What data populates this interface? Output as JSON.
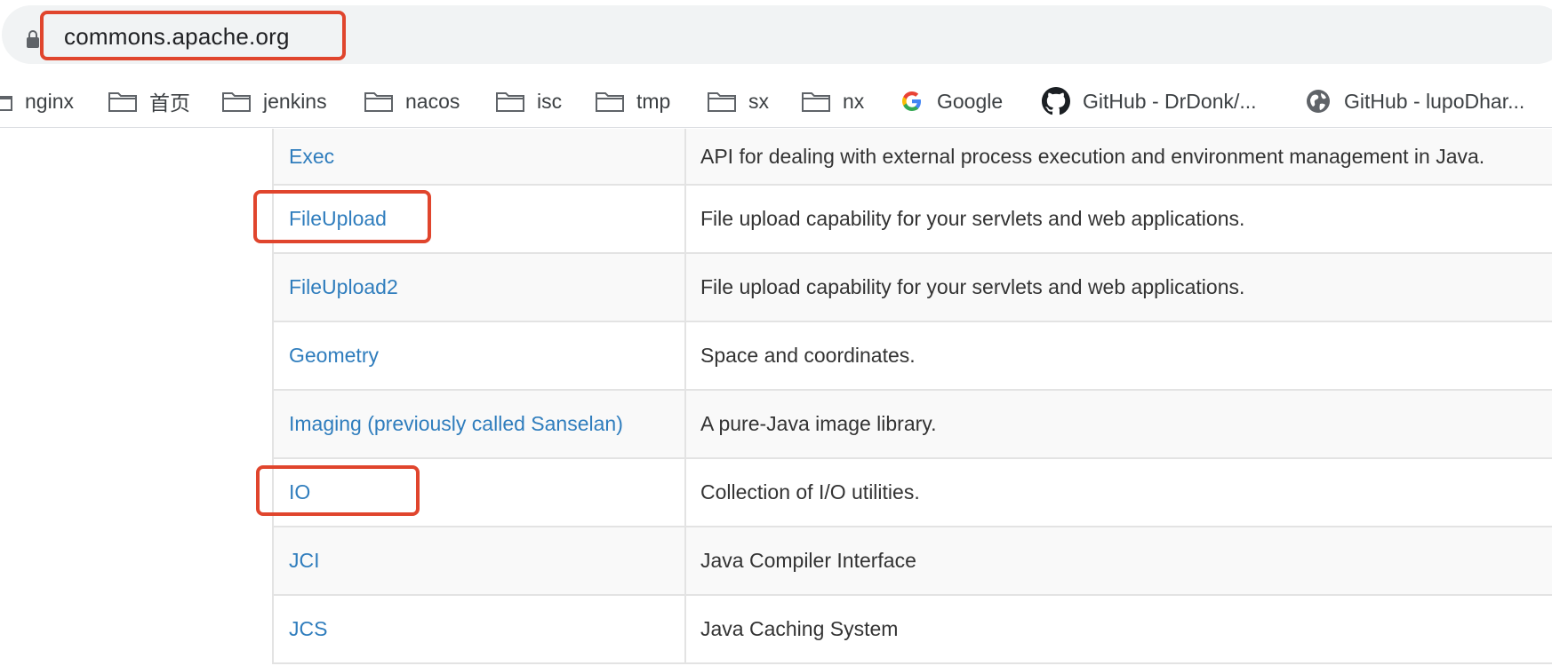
{
  "browser": {
    "url": "commons.apache.org",
    "lock_icon": "lock-icon"
  },
  "bookmarks": [
    {
      "label": "nginx",
      "icon": "folder-icon"
    },
    {
      "label": "首页",
      "icon": "folder-icon"
    },
    {
      "label": "jenkins",
      "icon": "folder-icon"
    },
    {
      "label": "nacos",
      "icon": "folder-icon"
    },
    {
      "label": "isc",
      "icon": "folder-icon"
    },
    {
      "label": "tmp",
      "icon": "folder-icon"
    },
    {
      "label": "sx",
      "icon": "folder-icon"
    },
    {
      "label": "nx",
      "icon": "folder-icon"
    },
    {
      "label": "Google",
      "icon": "google-icon"
    },
    {
      "label": "GitHub - DrDonk/...",
      "icon": "github-icon"
    },
    {
      "label": "GitHub - lupoDhar...",
      "icon": "globe-icon"
    }
  ],
  "components": [
    {
      "name": "Exec",
      "description": "API for dealing with external process execution and environment management in Java."
    },
    {
      "name": "FileUpload",
      "description": "File upload capability for your servlets and web applications."
    },
    {
      "name": "FileUpload2",
      "description": "File upload capability for your servlets and web applications."
    },
    {
      "name": "Geometry",
      "description": "Space and coordinates."
    },
    {
      "name": "Imaging (previously called Sanselan)",
      "description": "A pure-Java image library."
    },
    {
      "name": "IO",
      "description": "Collection of I/O utilities."
    },
    {
      "name": "JCI",
      "description": "Java Compiler Interface"
    },
    {
      "name": "JCS",
      "description": "Java Caching System"
    }
  ],
  "colors": {
    "link": "#2f7dbd",
    "highlight": "#e0452d"
  }
}
